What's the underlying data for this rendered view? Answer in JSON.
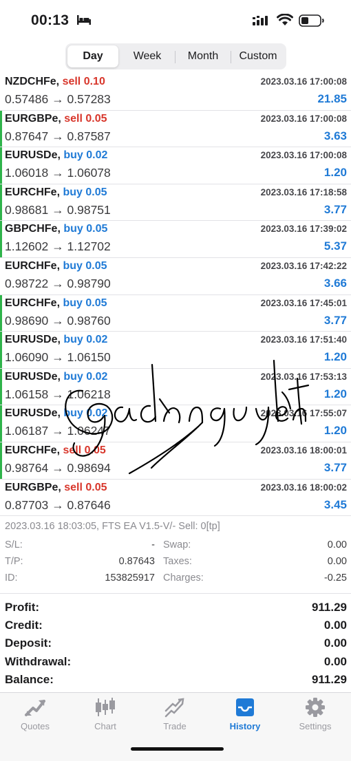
{
  "status_bar": {
    "time": "00:13"
  },
  "segmented": {
    "items": [
      "Day",
      "Week",
      "Month",
      "Custom"
    ],
    "active": "Day"
  },
  "trades": [
    {
      "symbol": "NZDCHFe,",
      "side": "sell",
      "volume": "0.10",
      "time": "2023.03.16 17:00:08",
      "open": "0.57486",
      "close": "0.57283",
      "profit": "21.85",
      "bar": false
    },
    {
      "symbol": "EURGBPe,",
      "side": "sell",
      "volume": "0.05",
      "time": "2023.03.16 17:00:08",
      "open": "0.87647",
      "close": "0.87587",
      "profit": "3.63",
      "bar": true
    },
    {
      "symbol": "EURUSDe,",
      "side": "buy",
      "volume": "0.02",
      "time": "2023.03.16 17:00:08",
      "open": "1.06018",
      "close": "1.06078",
      "profit": "1.20",
      "bar": true
    },
    {
      "symbol": "EURCHFe,",
      "side": "buy",
      "volume": "0.05",
      "time": "2023.03.16 17:18:58",
      "open": "0.98681",
      "close": "0.98751",
      "profit": "3.77",
      "bar": true
    },
    {
      "symbol": "GBPCHFe,",
      "side": "buy",
      "volume": "0.05",
      "time": "2023.03.16 17:39:02",
      "open": "1.12602",
      "close": "1.12702",
      "profit": "5.37",
      "bar": true
    },
    {
      "symbol": "EURCHFe,",
      "side": "buy",
      "volume": "0.05",
      "time": "2023.03.16 17:42:22",
      "open": "0.98722",
      "close": "0.98790",
      "profit": "3.66",
      "bar": false
    },
    {
      "symbol": "EURCHFe,",
      "side": "buy",
      "volume": "0.05",
      "time": "2023.03.16 17:45:01",
      "open": "0.98690",
      "close": "0.98760",
      "profit": "3.77",
      "bar": true
    },
    {
      "symbol": "EURUSDe,",
      "side": "buy",
      "volume": "0.02",
      "time": "2023.03.16 17:51:40",
      "open": "1.06090",
      "close": "1.06150",
      "profit": "1.20",
      "bar": true
    },
    {
      "symbol": "EURUSDe,",
      "side": "buy",
      "volume": "0.02",
      "time": "2023.03.16 17:53:13",
      "open": "1.06158",
      "close": "1.06218",
      "profit": "1.20",
      "bar": true
    },
    {
      "symbol": "EURUSDe,",
      "side": "buy",
      "volume": "0.02",
      "time": "2023.03.16 17:55:07",
      "open": "1.06187",
      "close": "1.06247",
      "profit": "1.20",
      "bar": true
    },
    {
      "symbol": "EURCHFe,",
      "side": "sell",
      "volume": "0.05",
      "time": "2023.03.16 18:00:01",
      "open": "0.98764",
      "close": "0.98694",
      "profit": "3.77",
      "bar": true
    },
    {
      "symbol": "EURGBPe,",
      "side": "sell",
      "volume": "0.05",
      "time": "2023.03.16 18:00:02",
      "open": "0.87703",
      "close": "0.87646",
      "profit": "3.45",
      "bar": false
    }
  ],
  "details": {
    "header": "2023.03.16 18:03:05, FTS EA V1.5-V/- Sell: 0[tp]",
    "sl_label": "S/L:",
    "sl_value": "-",
    "tp_label": "T/P:",
    "tp_value": "0.87643",
    "id_label": "ID:",
    "id_value": "153825917",
    "swap_label": "Swap:",
    "swap_value": "0.00",
    "taxes_label": "Taxes:",
    "taxes_value": "0.00",
    "charges_label": "Charges:",
    "charges_value": "-0.25"
  },
  "summary": [
    {
      "label": "Profit:",
      "value": "911.29"
    },
    {
      "label": "Credit:",
      "value": "0.00"
    },
    {
      "label": "Deposit:",
      "value": "0.00"
    },
    {
      "label": "Withdrawal:",
      "value": "0.00"
    },
    {
      "label": "Balance:",
      "value": "911.29"
    }
  ],
  "tabbar": [
    {
      "label": "Quotes",
      "icon": "quotes-icon",
      "active": false
    },
    {
      "label": "Chart",
      "icon": "candlestick-chart-icon",
      "active": false
    },
    {
      "label": "Trade",
      "icon": "trade-icon",
      "active": false
    },
    {
      "label": "History",
      "icon": "history-inbox-icon",
      "active": true
    },
    {
      "label": "Settings",
      "icon": "gear-icon",
      "active": false
    }
  ],
  "watermark": {
    "text": "@jacknguyenkt",
    "style": "handwritten-signature"
  },
  "colors": {
    "buy": "#1f7ad6",
    "sell": "#d8362b",
    "profit": "#1f7ad6",
    "bar": "#2fb34a",
    "active_tab": "#1f7ad6"
  }
}
